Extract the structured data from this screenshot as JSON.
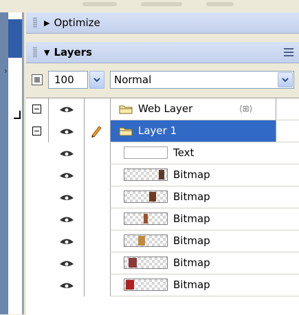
{
  "panels": {
    "optimize": {
      "label": "Optimize",
      "collapsed": true
    },
    "layers": {
      "label": "Layers",
      "collapsed": false
    }
  },
  "toolbar": {
    "opacity": "100",
    "blend_mode": "Normal"
  },
  "layers": [
    {
      "name": "Web Layer",
      "type": "folder",
      "expanded": true,
      "visible": true,
      "selected": false
    },
    {
      "name": "Layer 1",
      "type": "folder",
      "expanded": true,
      "visible": true,
      "selected": true
    },
    {
      "name": "Text",
      "type": "text",
      "visible": true
    },
    {
      "name": "Bitmap",
      "type": "bitmap",
      "visible": true
    },
    {
      "name": "Bitmap",
      "type": "bitmap",
      "visible": true
    },
    {
      "name": "Bitmap",
      "type": "bitmap",
      "visible": true
    },
    {
      "name": "Bitmap",
      "type": "bitmap",
      "visible": true
    },
    {
      "name": "Bitmap",
      "type": "bitmap",
      "visible": true
    },
    {
      "name": "Bitmap",
      "type": "bitmap",
      "visible": true
    }
  ],
  "colors": {
    "selection": "#3169C6",
    "panel_header": "#C3D1EC",
    "panel_bg": "#ECE9D8"
  }
}
